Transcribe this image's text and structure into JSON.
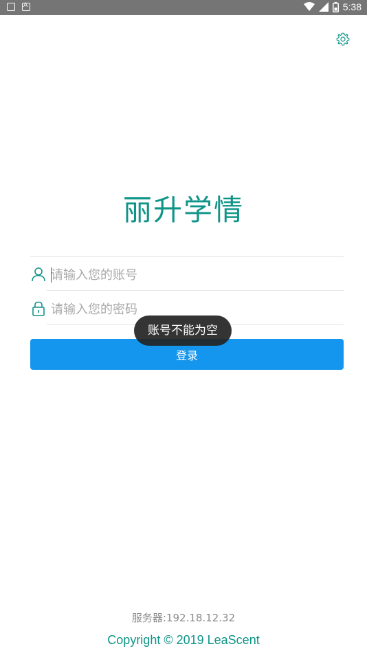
{
  "status_bar": {
    "time": "5:38",
    "icons": [
      "notification-icon",
      "a-icon",
      "wifi-icon",
      "signal-icon",
      "battery-icon"
    ]
  },
  "app": {
    "title": "丽升学情"
  },
  "login_form": {
    "account_placeholder": "请输入您的账号",
    "account_value": "",
    "password_placeholder": "请输入您的密码",
    "password_value": "",
    "login_label": "登录"
  },
  "toast": {
    "message": "账号不能为空"
  },
  "footer": {
    "server": "服务器:192.18.12.32",
    "copyright": "Copyright © 2019 LeaScent"
  },
  "colors": {
    "accent": "#0f9488",
    "button": "#1596ee",
    "status_bar": "#757575",
    "toast": "#232323"
  }
}
